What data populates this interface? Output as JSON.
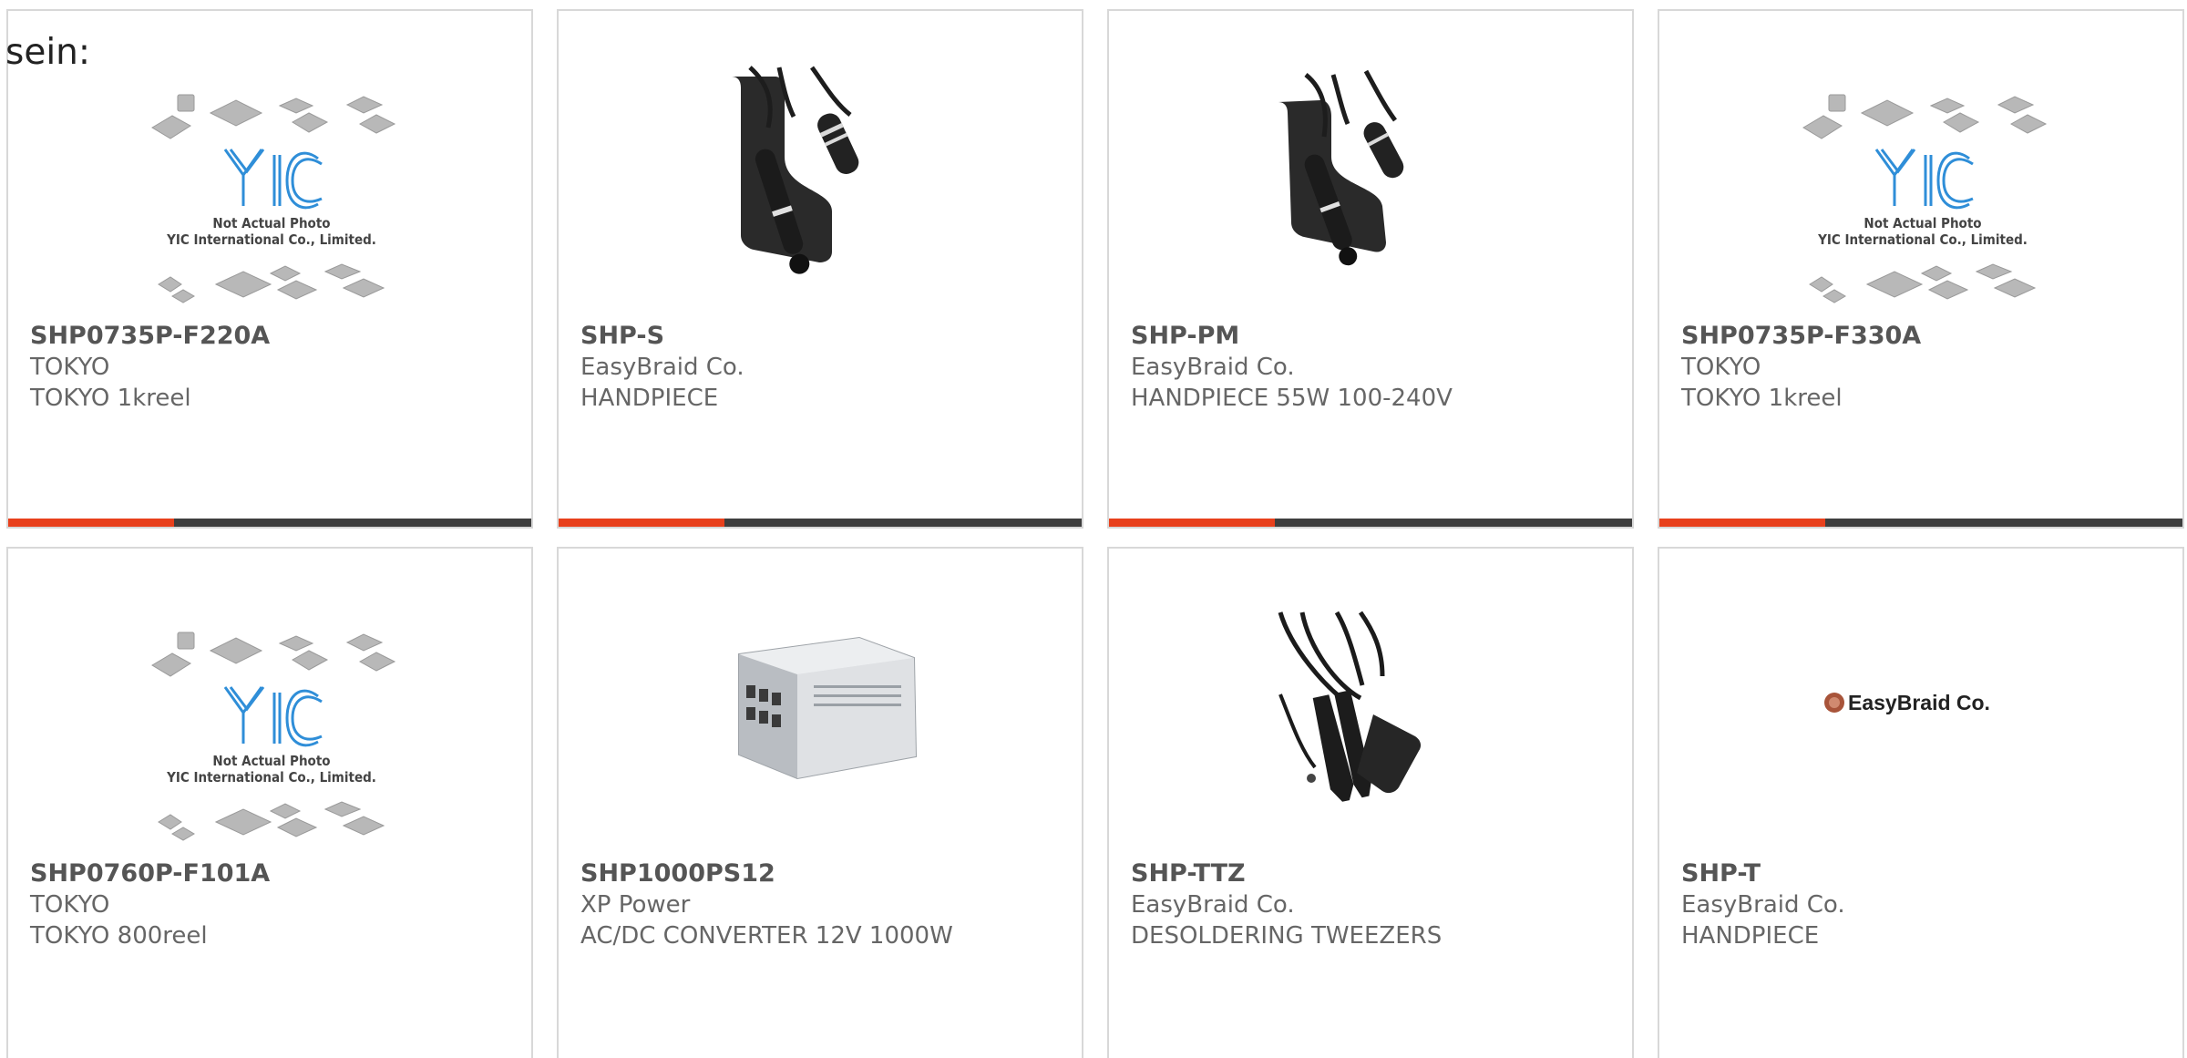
{
  "intro_text": "sein:",
  "colors": {
    "accent": "#e8401c",
    "bar": "#3e3e3e",
    "border": "#d8d8d8",
    "yic_blue": "#2f8ed8"
  },
  "placeholder_image": {
    "line1": "Not Actual Photo",
    "line2": "YIC International Co., Limited.",
    "logo": "YIC"
  },
  "brand_logo_text": "EasyBraid Co.",
  "products": [
    {
      "part_number": "SHP0735P-F220A",
      "manufacturer": "TOKYO",
      "description": "TOKYO 1kreel",
      "image": "yic-placeholder-image"
    },
    {
      "part_number": "SHP-S",
      "manufacturer": "EasyBraid Co.",
      "description": "HANDPIECE",
      "image": "handpiece-photo"
    },
    {
      "part_number": "SHP-PM",
      "manufacturer": "EasyBraid Co.",
      "description": "HANDPIECE 55W 100-240V",
      "image": "handpiece-photo"
    },
    {
      "part_number": "SHP0735P-F330A",
      "manufacturer": "TOKYO",
      "description": "TOKYO 1kreel",
      "image": "yic-placeholder-image"
    },
    {
      "part_number": "SHP0760P-F101A",
      "manufacturer": "TOKYO",
      "description": "TOKYO 800reel",
      "image": "yic-placeholder-image"
    },
    {
      "part_number": "SHP1000PS12",
      "manufacturer": "XP Power",
      "description": "AC/DC CONVERTER 12V 1000W",
      "image": "power-supply-photo"
    },
    {
      "part_number": "SHP-TTZ",
      "manufacturer": "EasyBraid Co.",
      "description": "DESOLDERING TWEEZERS",
      "image": "tweezers-photo"
    },
    {
      "part_number": "SHP-T",
      "manufacturer": "EasyBraid Co.",
      "description": "HANDPIECE",
      "image": "easybraid-logo"
    }
  ]
}
